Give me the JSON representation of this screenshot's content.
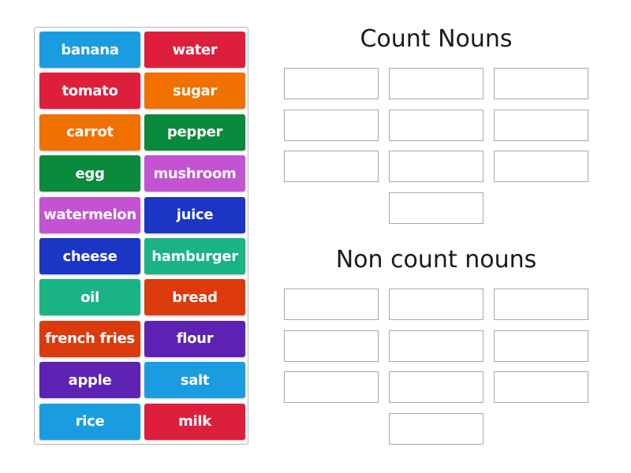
{
  "tiles": [
    {
      "label": "banana",
      "color": "#1a9de0"
    },
    {
      "label": "water",
      "color": "#dd1f3b"
    },
    {
      "label": "tomato",
      "color": "#dd1f3b"
    },
    {
      "label": "sugar",
      "color": "#f07000"
    },
    {
      "label": "carrot",
      "color": "#f07000"
    },
    {
      "label": "pepper",
      "color": "#0a8a3c"
    },
    {
      "label": "egg",
      "color": "#0a8a3c"
    },
    {
      "label": "mushroom",
      "color": "#c453d4"
    },
    {
      "label": "watermelon",
      "color": "#c453d4"
    },
    {
      "label": "juice",
      "color": "#1b35c4"
    },
    {
      "label": "cheese",
      "color": "#1b35c4"
    },
    {
      "label": "hamburger",
      "color": "#1ab384"
    },
    {
      "label": "oil",
      "color": "#1ab384"
    },
    {
      "label": "bread",
      "color": "#db3a0c"
    },
    {
      "label": "french fries",
      "color": "#db3a0c"
    },
    {
      "label": "flour",
      "color": "#5d22b3"
    },
    {
      "label": "apple",
      "color": "#5d22b3"
    },
    {
      "label": "salt",
      "color": "#1a9de0"
    },
    {
      "label": "rice",
      "color": "#1a9de0"
    },
    {
      "label": "milk",
      "color": "#dd1f3b"
    }
  ],
  "groups": [
    {
      "title": "Count Nouns",
      "slots": 10
    },
    {
      "title": "Non count nouns",
      "slots": 10
    }
  ]
}
